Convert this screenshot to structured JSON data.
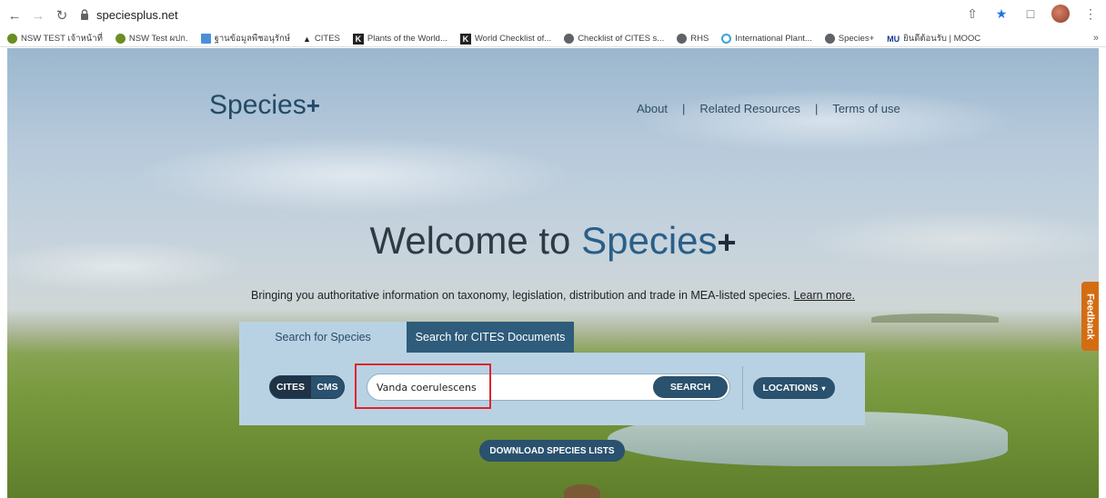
{
  "browser": {
    "url": "speciesplus.net",
    "bookmarks": [
      {
        "label": "NSW TEST เจ้าหน้าที่",
        "icon": "green-circle-icon",
        "color": "#6b8e23"
      },
      {
        "label": "NSW Test ผปก.",
        "icon": "green-circle-icon",
        "color": "#6b8e23"
      },
      {
        "label": "ฐานข้อมูลพืชอนุรักษ์",
        "icon": "doc-icon",
        "color": "#4a90d9"
      },
      {
        "label": "CITES",
        "icon": "cites-logo-icon",
        "color": "#222222"
      },
      {
        "label": "Plants of the World...",
        "icon": "k-logo-icon",
        "color": "#222222"
      },
      {
        "label": "World Checklist of...",
        "icon": "k-logo-icon",
        "color": "#222222"
      },
      {
        "label": "Checklist of CITES s...",
        "icon": "globe-icon",
        "color": "#5f6368"
      },
      {
        "label": "RHS",
        "icon": "globe-icon",
        "color": "#5f6368"
      },
      {
        "label": "International Plant...",
        "icon": "circle-icon",
        "color": "#3ba3d9"
      },
      {
        "label": "Species+",
        "icon": "globe-icon",
        "color": "#5f6368"
      },
      {
        "label": "ยินดีต้อนรับ | MOOC",
        "icon": "mu-logo-icon",
        "color": "#1a3a8a"
      }
    ],
    "more": "»"
  },
  "site": {
    "logo": "Species",
    "logo_plus": "+",
    "nav": [
      "About",
      "Related Resources",
      "Terms of use"
    ],
    "nav_sep": "|",
    "welcome": "Welcome to",
    "welcome_accent": "Species",
    "welcome_plus": "+",
    "tagline": "Bringing you authoritative information on taxonomy, legislation, distribution and trade in MEA-listed species.",
    "learn_more": "Learn more.",
    "tabs": {
      "species": "Search for Species",
      "cites": "Search for CITES Documents"
    },
    "toggle": {
      "cites": "CITES",
      "cms": "CMS"
    },
    "search": {
      "value": "Vanda coerulescens",
      "button": "SEARCH"
    },
    "locations": "LOCATIONS",
    "download": "DOWNLOAD SPECIES LISTS",
    "feedback": "Feedback"
  }
}
